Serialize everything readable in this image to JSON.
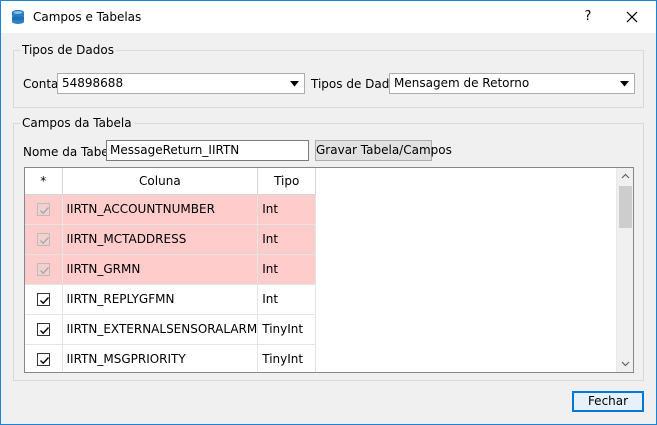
{
  "window": {
    "title": "Campos e Tabelas",
    "help_label": "?",
    "app_icon": "database-icon",
    "close_icon": "close-icon"
  },
  "tipos_group": {
    "title": "Tipos de Dados",
    "conta_label": "Conta",
    "conta_value": "54898688",
    "tipos_label": "Tipos de Dados",
    "tipos_value": "Mensagem de Retorno"
  },
  "campos_group": {
    "title": "Campos da Tabela",
    "nome_label": "Nome da Tabela",
    "nome_value": "MessageReturn_IIRTN",
    "gravar_label": "Gravar Tabela/Campos"
  },
  "table": {
    "columns": [
      "*",
      "Coluna",
      "Tipo"
    ],
    "rows": [
      {
        "checked": true,
        "primary_key": true,
        "coluna": "IIRTN_ACCOUNTNUMBER",
        "tipo": "Int"
      },
      {
        "checked": true,
        "primary_key": true,
        "coluna": "IIRTN_MCTADDRESS",
        "tipo": "Int"
      },
      {
        "checked": true,
        "primary_key": true,
        "coluna": "IIRTN_GRMN",
        "tipo": "Int"
      },
      {
        "checked": true,
        "primary_key": false,
        "coluna": "IIRTN_REPLYGFMN",
        "tipo": "Int"
      },
      {
        "checked": true,
        "primary_key": false,
        "coluna": "IIRTN_EXTERNALSENSORALARM",
        "tipo": "TinyInt"
      },
      {
        "checked": true,
        "primary_key": false,
        "coluna": "IIRTN_MSGPRIORITY",
        "tipo": "TinyInt"
      }
    ],
    "primary_key_color": "#ffcccc"
  },
  "footer": {
    "fechar_label": "Fechar"
  },
  "colors": {
    "accent": "#0078d7",
    "window_border": "#1883d7"
  }
}
